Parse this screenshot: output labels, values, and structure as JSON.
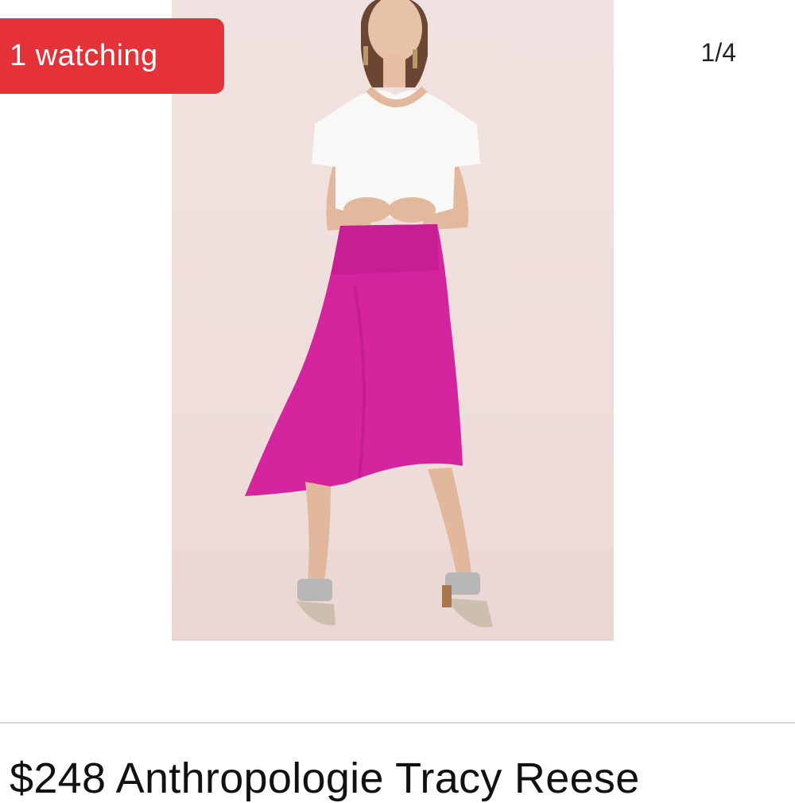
{
  "badge": {
    "watching_label": "1 watching",
    "color": "#e53238"
  },
  "gallery": {
    "counter": "1/4",
    "image_description_icon": "product-photo-icon"
  },
  "listing": {
    "title": "$248 Anthropologie Tracy Reese"
  },
  "colors": {
    "skirt": "#d4259f",
    "top": "#f8f8f6",
    "backdrop": "#efdedb"
  }
}
